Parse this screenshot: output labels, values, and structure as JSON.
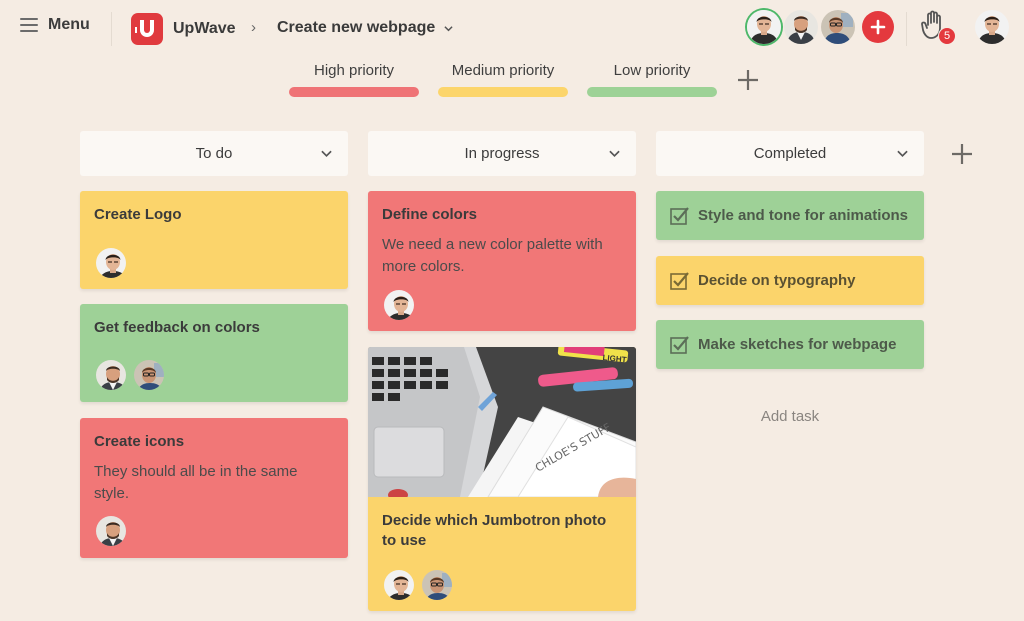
{
  "topbar": {
    "menu_label": "Menu",
    "brand_name": "UpWave",
    "breadcrumb_separator": "›",
    "project_title": "Create new webpage",
    "notification_count": "5"
  },
  "priorities": [
    {
      "label": "High priority",
      "color": "#ef7376"
    },
    {
      "label": "Medium priority",
      "color": "#fcd56b"
    },
    {
      "label": "Low priority",
      "color": "#9dd296"
    }
  ],
  "columns": [
    {
      "title": "To do"
    },
    {
      "title": "In progress"
    },
    {
      "title": "Completed"
    }
  ],
  "todo_cards": [
    {
      "title": "Create Logo",
      "description": "",
      "color": "yellow"
    },
    {
      "title": "Get feedback on colors",
      "description": "",
      "color": "green"
    },
    {
      "title": "Create icons",
      "description": "They should all be in the same style.",
      "color": "red"
    }
  ],
  "progress_cards": [
    {
      "title": "Define colors",
      "description": "We need a new color palette with more colors.",
      "color": "red"
    },
    {
      "title": "Decide which Jumbotron photo to use",
      "description": "",
      "color": "yellow",
      "has_photo": true
    }
  ],
  "completed_cards": [
    {
      "title": "Style and tone for animations",
      "color": "green",
      "done": true
    },
    {
      "title": "Decide on typography",
      "color": "yellow",
      "done": true
    },
    {
      "title": "Make sketches for webpage",
      "color": "green",
      "done": true
    }
  ],
  "add_task_label": "Add task",
  "photo_text": {
    "highlighter": "LIGHT",
    "sketch": "CHLOE'S STUFF"
  },
  "colors": {
    "background": "#f5ece3",
    "brand_red": "#e03a3e",
    "card_yellow": "#fbd46b",
    "card_green": "#9ed197",
    "card_red": "#f17777"
  }
}
